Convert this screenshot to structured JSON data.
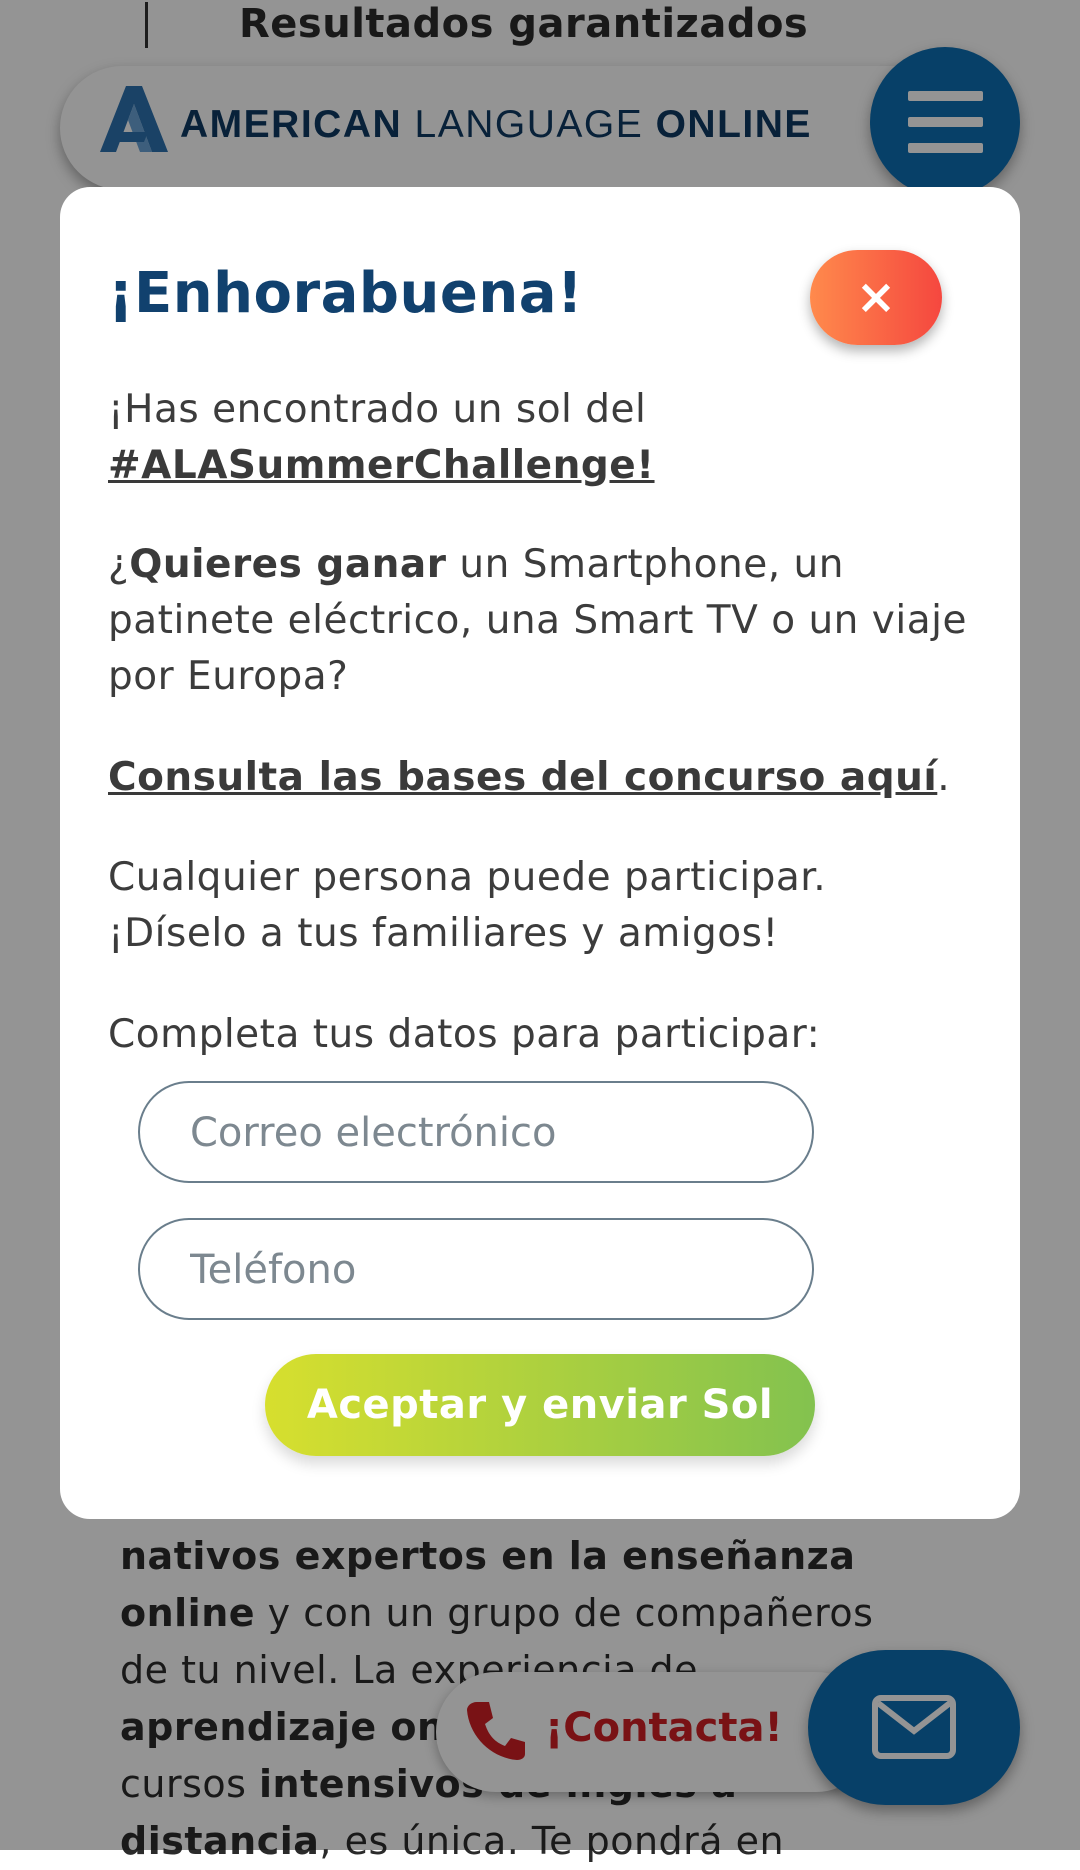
{
  "background": {
    "top_title": "Resultados garantizados",
    "logo": {
      "part1": "AMERICAN",
      "part2": "LANGUAGE",
      "part3": "ONLINE"
    },
    "body_text": {
      "line1_bold": "nativos expertos en la enseñanza",
      "line2_bold": "online",
      "line2_rest": " y con un grupo de compañeros",
      "line3": "de tu nivel. La experiencia de",
      "line4_bold": "aprendizaje on",
      "line5_start": "cursos ",
      "line5_bold": "intensivos de inglés a",
      "line6_bold": "distancia",
      "line6_rest": ", es única. Te pondrá en"
    },
    "contact_label": "¡Contacta!"
  },
  "modal": {
    "title": "¡Enhorabuena!",
    "close_label": "×",
    "para1_text": "¡Has encontrado un sol del",
    "para1_link": "#ALASummerChallenge!",
    "para2_pre": "¿",
    "para2_bold": "Quieres ganar",
    "para2_rest": " un Smartphone, un patinete eléctrico, una Smart TV o un viaje por Europa?",
    "para3_link": "Consulta las bases del concurso aquí",
    "para3_end": ".",
    "para4_line1": "Cualquier persona puede participar.",
    "para4_line2": "¡Díselo a tus familiares y amigos!",
    "para5": "Completa tus datos para participar:",
    "email_placeholder": "Correo electrónico",
    "phone_placeholder": "Teléfono",
    "submit_label": "Aceptar y enviar Sol"
  },
  "colors": {
    "brand_blue": "#0d6fb3",
    "title_navy": "#11416e",
    "close_gradient": [
      "#ff8a4c",
      "#f5473f"
    ],
    "submit_gradient": [
      "#d7df2e",
      "#83c24f"
    ],
    "contact_red": "#d01f25"
  },
  "icons": [
    "logo-a-icon",
    "hamburger-menu-icon",
    "close-icon",
    "phone-icon",
    "mail-icon"
  ]
}
